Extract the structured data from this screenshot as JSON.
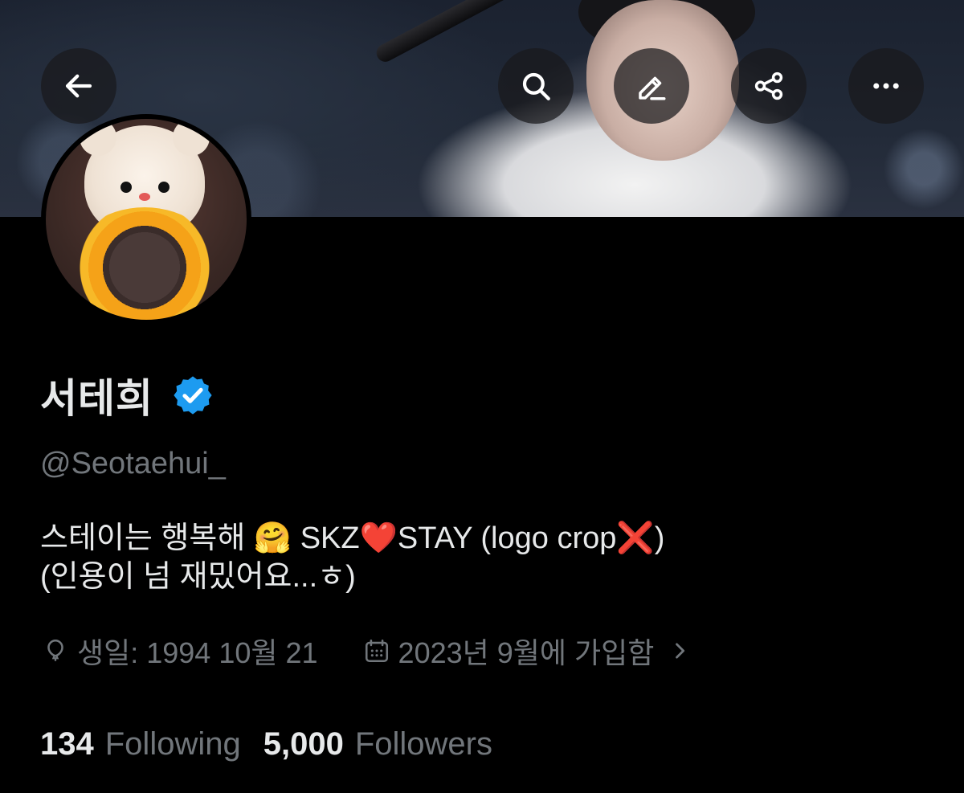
{
  "profile": {
    "display_name": "서테희",
    "handle": "@Seotaehui_",
    "bio_lines": [
      "스테이는 행복해 🤗 SKZ❤️STAY (logo crop❌)",
      "(인용이 넘 재밌어요...ㅎ)"
    ],
    "birthday": "생일: 1994 10월 21",
    "joined": "2023년 9월에 가입함",
    "following_count": "134",
    "following_label": "Following",
    "followers_count": "5,000",
    "followers_label": "Followers"
  },
  "toolbar": {
    "back_icon": "arrow-left-icon",
    "search_icon": "search-icon",
    "edit_icon": "pencil-icon",
    "share_icon": "share-icon",
    "more_icon": "more-horizontal-icon"
  },
  "colors": {
    "background": "#000000",
    "primary_text": "#e7e9ea",
    "secondary_text": "#71767b",
    "verified_badge": "#1d9bf0"
  }
}
